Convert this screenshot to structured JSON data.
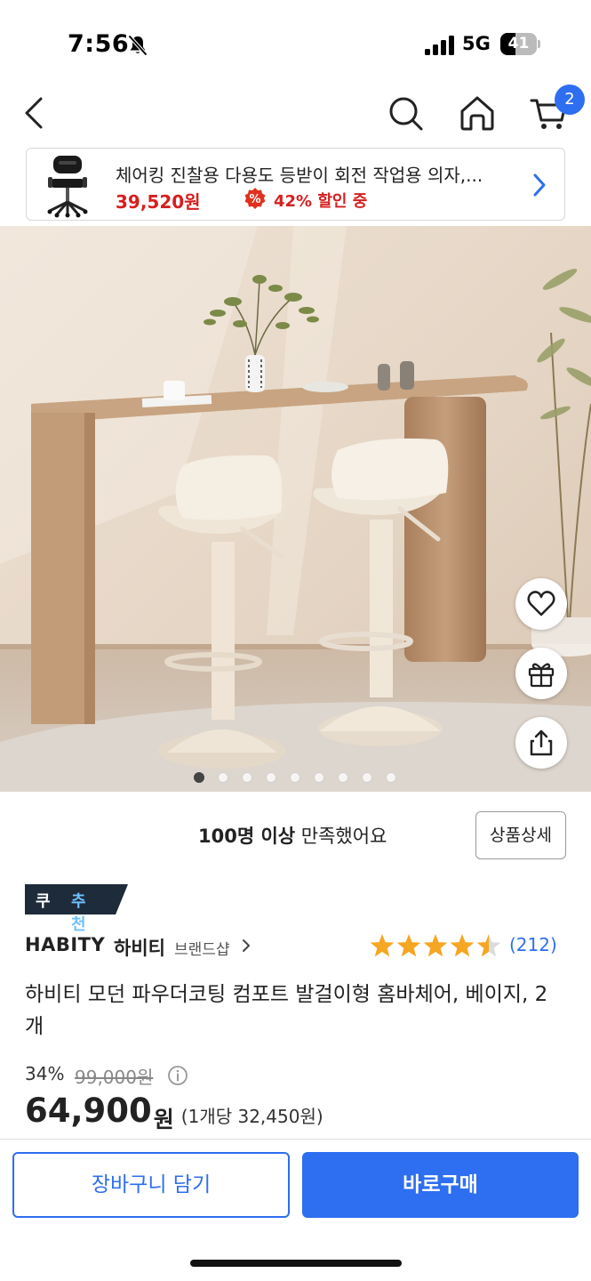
{
  "status_bar": {
    "time": "7:56",
    "network": "5G",
    "battery_level": "41",
    "battery_fraction": 0.41
  },
  "nav": {
    "cart_badge": "2",
    "accent": "#2e6ef0"
  },
  "recommend_banner": {
    "title": "체어킹 진찰용 다용도 등받이 회전 작업용 의자,...",
    "price": "39,520원",
    "discount": "42% 할인 중",
    "price_color": "#d61f1f"
  },
  "gallery": {
    "slide_count": 9,
    "active_index": 0,
    "actions": [
      "heart-icon",
      "gift-icon",
      "share-icon"
    ]
  },
  "satisfaction": {
    "bold": "100명 이상",
    "rest": " 만족했어요",
    "detail_button": "상품상세"
  },
  "badge": {
    "part1": "쿠팡",
    "part2": "추천"
  },
  "brand": {
    "english": "HABITY",
    "korean": "하비티",
    "shop_link": "브랜드샵",
    "rating": 4.5,
    "review_count": "(212)"
  },
  "product": {
    "name": "하비티 모던 파우더코팅 컴포트 발걸이형 홈바체어, 베이지, 2개"
  },
  "price": {
    "discount_rate": "34%",
    "original": "99,000원",
    "sale": "64,900",
    "unit": "원",
    "per_unit": "(1개당 32,450원)"
  },
  "actions": {
    "add_to_cart": "장바구니 담기",
    "buy_now": "바로구매"
  }
}
